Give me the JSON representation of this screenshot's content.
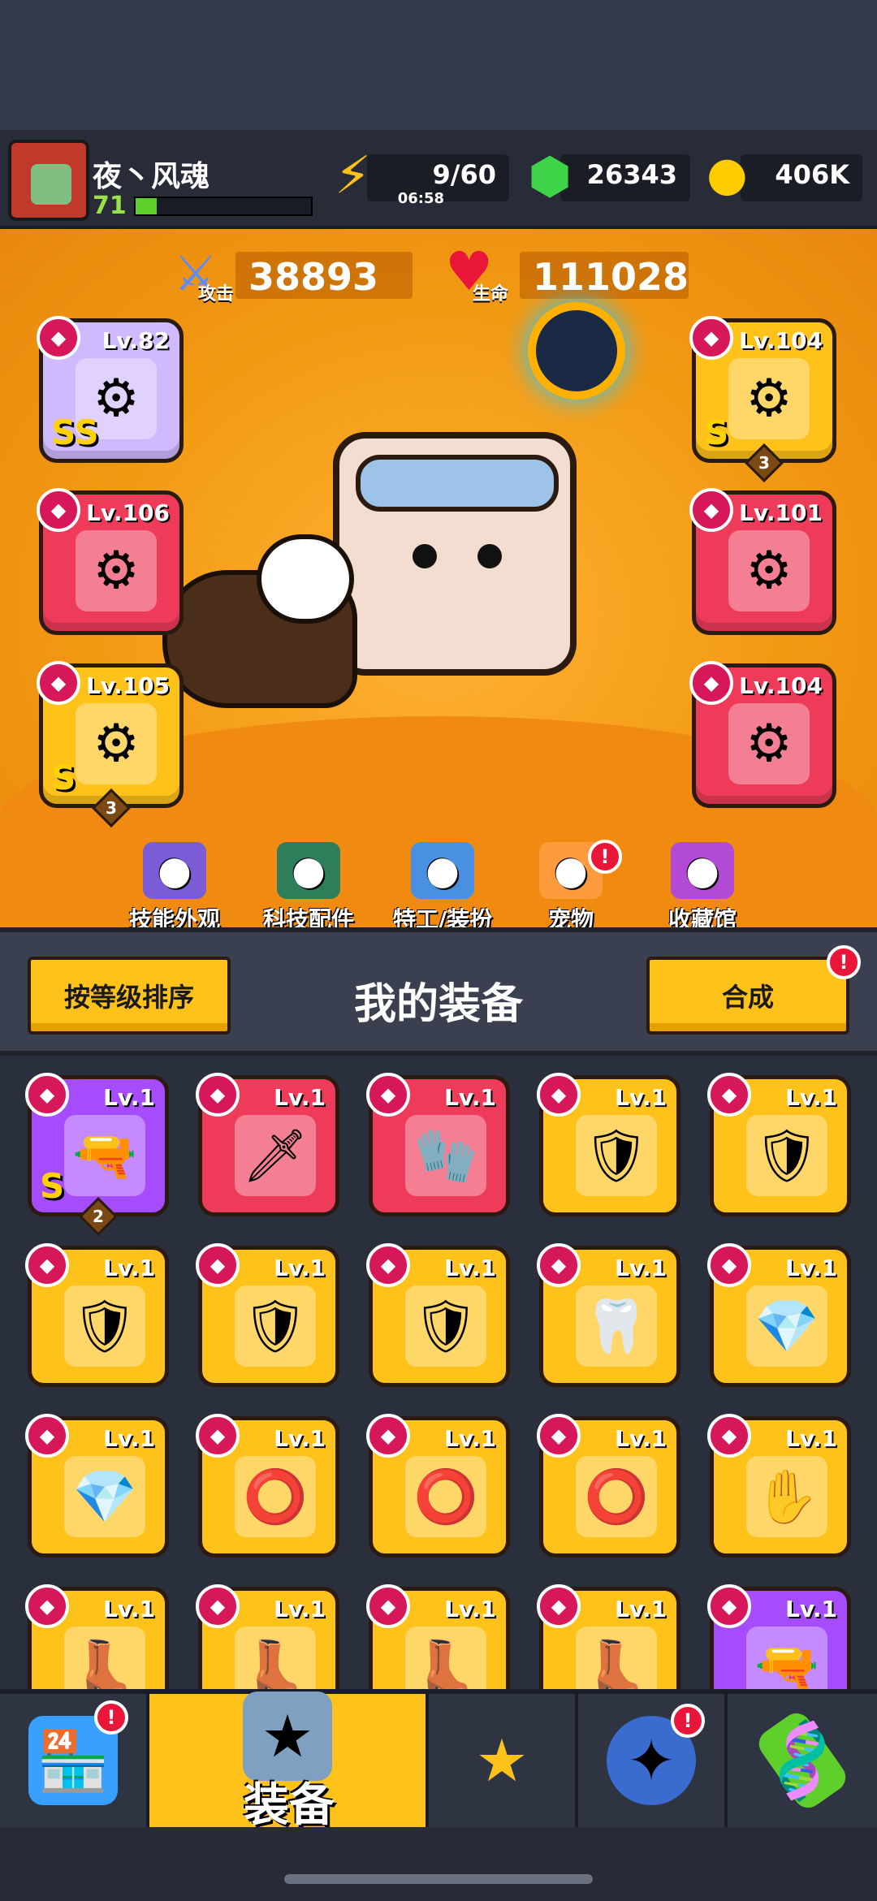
{
  "player": {
    "name": "夜丶风魂",
    "level": "71",
    "xp_fraction": 0.12
  },
  "resources": {
    "energy": "9/60",
    "energy_timer": "06:58",
    "gems": "26343",
    "coins": "406K"
  },
  "stats": {
    "attack_value": "38893",
    "attack_label": "攻击",
    "hp_value": "111028",
    "hp_label": "生命"
  },
  "equipped": {
    "left": [
      {
        "level": "Lv.82",
        "rarity": "lavender",
        "grade": "SS"
      },
      {
        "level": "Lv.106",
        "rarity": "red"
      },
      {
        "level": "Lv.105",
        "rarity": "gold",
        "grade": "S",
        "stars": "3"
      }
    ],
    "right": [
      {
        "level": "Lv.104",
        "rarity": "gold",
        "grade": "S",
        "stars": "3"
      },
      {
        "level": "Lv.101",
        "rarity": "red"
      },
      {
        "level": "Lv.104",
        "rarity": "red"
      }
    ]
  },
  "features": [
    {
      "label": "技能外观",
      "icon": "skill-skin-icon"
    },
    {
      "label": "科技配件",
      "icon": "tech-part-icon"
    },
    {
      "label": "特工/装扮",
      "icon": "agent-costume-icon"
    },
    {
      "label": "宠物",
      "icon": "pet-icon",
      "alert": "!"
    },
    {
      "label": "收藏馆",
      "icon": "collection-icon"
    }
  ],
  "equipment_panel": {
    "sort_button": "按等级排序",
    "title": "我的装备",
    "merge_button": "合成",
    "merge_alert": "!"
  },
  "inventory": [
    {
      "level": "Lv.1",
      "rarity": "purple",
      "grade": "S",
      "stars": "2",
      "icon": "blaster-icon"
    },
    {
      "level": "Lv.1",
      "rarity": "red",
      "icon": "kunai-icon"
    },
    {
      "level": "Lv.1",
      "rarity": "red",
      "icon": "gauntlet-icon"
    },
    {
      "level": "Lv.1",
      "rarity": "gold",
      "icon": "armor-icon"
    },
    {
      "level": "Lv.1",
      "rarity": "gold",
      "icon": "armor-icon"
    },
    {
      "level": "Lv.1",
      "rarity": "gold",
      "icon": "armor-icon"
    },
    {
      "level": "Lv.1",
      "rarity": "gold",
      "icon": "armor-icon"
    },
    {
      "level": "Lv.1",
      "rarity": "gold",
      "icon": "armor-icon"
    },
    {
      "level": "Lv.1",
      "rarity": "gold",
      "icon": "fang-necklace-icon"
    },
    {
      "level": "Lv.1",
      "rarity": "gold",
      "icon": "gem-necklace-icon"
    },
    {
      "level": "Lv.1",
      "rarity": "gold",
      "icon": "gem-necklace-icon"
    },
    {
      "level": "Lv.1",
      "rarity": "gold",
      "icon": "belt-icon"
    },
    {
      "level": "Lv.1",
      "rarity": "gold",
      "icon": "belt-icon"
    },
    {
      "level": "Lv.1",
      "rarity": "gold",
      "icon": "belt-icon"
    },
    {
      "level": "Lv.1",
      "rarity": "gold",
      "icon": "glove-icon"
    },
    {
      "level": "Lv.1",
      "rarity": "gold",
      "icon": "boot-icon"
    },
    {
      "level": "Lv.1",
      "rarity": "gold",
      "icon": "boot-icon"
    },
    {
      "level": "Lv.1",
      "rarity": "gold",
      "icon": "boot-icon"
    },
    {
      "level": "Lv.1",
      "rarity": "gold",
      "icon": "boot-icon"
    },
    {
      "level": "Lv.1",
      "rarity": "purple",
      "icon": "rifle-icon"
    }
  ],
  "nav": {
    "active_label": "装备",
    "tabs": [
      "shop-icon",
      "equipment-icon",
      "skills-star-icon",
      "challenge-orb-icon",
      "dna-lab-icon"
    ],
    "alert": "!"
  }
}
